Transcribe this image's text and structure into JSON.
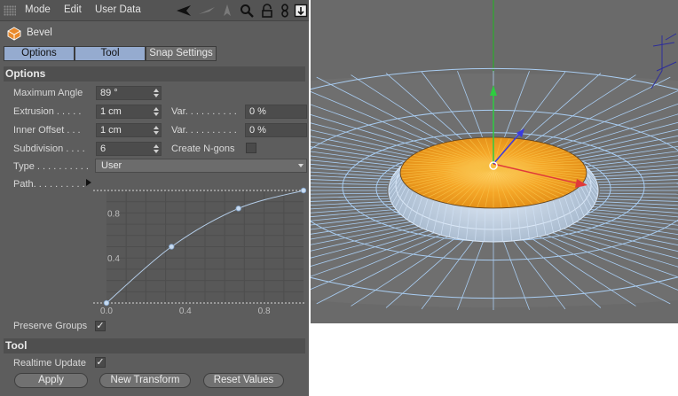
{
  "menubar": {
    "items": [
      "Mode",
      "Edit",
      "User Data"
    ],
    "icons": [
      "arrow-left-icon",
      "arrow-up-icon",
      "search-icon",
      "lock-icon",
      "link-icon",
      "new-panel-icon"
    ]
  },
  "object": {
    "name": "Bevel",
    "icon": "bevel-object-icon"
  },
  "tabs": [
    {
      "label": "Options",
      "active": true
    },
    {
      "label": "Tool",
      "active": true
    },
    {
      "label": "Snap Settings",
      "active": false
    }
  ],
  "options": {
    "heading": "Options",
    "max_angle": {
      "label": "Maximum Angle",
      "value": "89 °"
    },
    "extrusion": {
      "label": "Extrusion . . . . .",
      "value": "1 cm",
      "var_label": "Var. . . . . . . . . .",
      "var_value": "0 %"
    },
    "inner_offset": {
      "label": "Inner Offset . . .",
      "value": "1 cm",
      "var_label": "Var. . . . . . . . . .",
      "var_value": "0 %"
    },
    "subdivision": {
      "label": "Subdivision . . . .",
      "value": "6",
      "ngons_label": "Create N-gons",
      "ngons_checked": false
    },
    "type": {
      "label": "Type . . . . . . . . . .",
      "value": "User"
    },
    "path": {
      "label": "Path. . . . . . . . . ."
    },
    "preserve_groups": {
      "label": "Preserve Groups",
      "checked": true
    }
  },
  "graph": {
    "x_ticks": [
      "0.0",
      "0.4",
      "0.8"
    ],
    "y_ticks": [
      "0.8",
      "0.4"
    ],
    "points": [
      [
        0.0,
        0.0
      ],
      [
        0.33,
        0.5
      ],
      [
        0.67,
        0.84
      ],
      [
        1.0,
        1.0
      ]
    ],
    "xlim": [
      0,
      1
    ],
    "ylim": [
      0,
      1
    ]
  },
  "tool": {
    "heading": "Tool",
    "realtime": {
      "label": "Realtime Update",
      "checked": true
    },
    "buttons": {
      "apply": "Apply",
      "new_transform": "New Transform",
      "reset": "Reset Values"
    }
  },
  "colors": {
    "panel_bg": "#5d5d5d",
    "tab_active": "#95abcf",
    "viewport_bg": "#6a6a6a",
    "wire": "#a9cdf2",
    "selected_face": "#f2a023",
    "axis_x": "#e03a3a",
    "axis_y": "#2ecc40",
    "axis_z": "#3a3ae0"
  }
}
